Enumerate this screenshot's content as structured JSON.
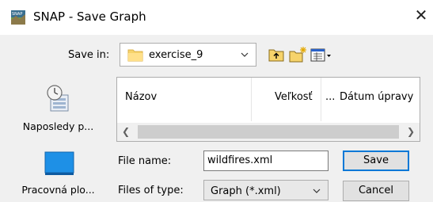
{
  "window": {
    "title": "SNAP - Save Graph",
    "app_icon_text": "SNAP"
  },
  "save_in": {
    "label": "Save in:",
    "folder": "exercise_9"
  },
  "toolbar": {
    "buttons": [
      "up-folder-icon",
      "new-folder-icon",
      "view-menu-icon"
    ]
  },
  "places": [
    {
      "label": "Naposledy p...",
      "icon": "recent-places-icon"
    },
    {
      "label": "Pracovná plo...",
      "icon": "desktop-icon"
    }
  ],
  "file_list": {
    "columns": [
      "Názov",
      "Veľkosť",
      "...",
      "Dátum úpravy"
    ]
  },
  "file_name": {
    "label": "File name:",
    "value": "wildfires.xml"
  },
  "file_type": {
    "label": "Files of type:",
    "value": "Graph (*.xml)"
  },
  "buttons": {
    "save": "Save",
    "cancel": "Cancel"
  },
  "colors": {
    "accent": "#0078d7",
    "dialog_bg": "#f0f0f0"
  }
}
